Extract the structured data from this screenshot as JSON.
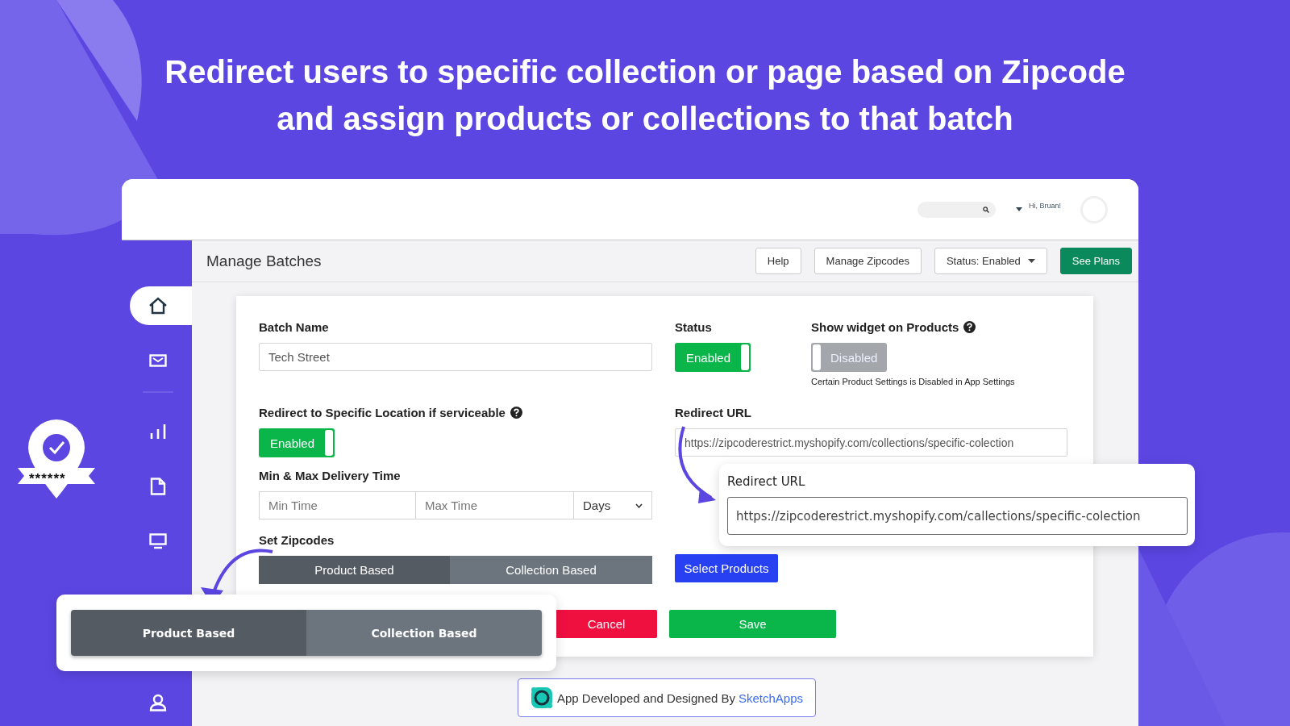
{
  "headline": [
    "Redirect users to specific collection or page based on Zipcode",
    "and assign products or collections to that batch"
  ],
  "badge": {
    "text": "******"
  },
  "topbar": {
    "greeting": "Hi, Bruan!"
  },
  "sidebar": {
    "items": [
      {
        "kind": "home",
        "selected": true
      },
      {
        "kind": "mail",
        "selected": false
      },
      {
        "kind": "chart",
        "selected": false
      },
      {
        "kind": "file",
        "selected": false
      },
      {
        "kind": "monitor",
        "selected": false
      },
      {
        "kind": "user",
        "selected": false
      }
    ]
  },
  "page": {
    "title": "Manage Batches",
    "buttons": [
      {
        "label": "Help",
        "kind": "outline"
      },
      {
        "label": "Manage Zipcodes",
        "kind": "outline"
      },
      {
        "label": "Status: Enabled",
        "kind": "dropdown"
      },
      {
        "label": "See Plans",
        "kind": "primary"
      }
    ]
  },
  "form": {
    "batch_name": {
      "label": "Batch Name",
      "value": "Tech Street"
    },
    "status": {
      "label": "Status",
      "toggle": {
        "on": true,
        "text": "Enabled"
      }
    },
    "widget": {
      "label": "Show widget on Products",
      "toggle": {
        "on": false,
        "text": "Disabled"
      },
      "note": "Certain Product Settings is Disabled in App Settings"
    },
    "redirect": {
      "label": "Redirect to Specific Location if serviceable",
      "toggle": {
        "on": true,
        "text": "Enabled"
      }
    },
    "redirect_url": {
      "label": "Redirect URL",
      "value": "https://zipcoderestrict.myshopify.com/collections/specific-colection"
    },
    "delivery": {
      "label": "Min & Max Delivery Time",
      "min_placeholder": "Min Time",
      "max_placeholder": "Max Time",
      "unit": "Days"
    },
    "zipcodes": {
      "label": "Set Zipcodes",
      "options": [
        {
          "label": "Product Based",
          "selected": true
        },
        {
          "label": "Collection Based",
          "selected": false
        }
      ]
    },
    "select_button": "Select Products",
    "actions": [
      {
        "label": "Cancel",
        "kind": "danger"
      },
      {
        "label": "Save",
        "kind": "success"
      }
    ]
  },
  "url_callout": {
    "label": "Redirect URL",
    "value": "https://zipcoderestrict.myshopify.com/callections/specific-colection"
  },
  "mode_callout": {
    "options": [
      {
        "label": "Product Based",
        "selected": true
      },
      {
        "label": "Collection Based",
        "selected": false
      }
    ]
  },
  "footer": {
    "text": "App Developed and Designed By",
    "link": "SketchApps"
  }
}
